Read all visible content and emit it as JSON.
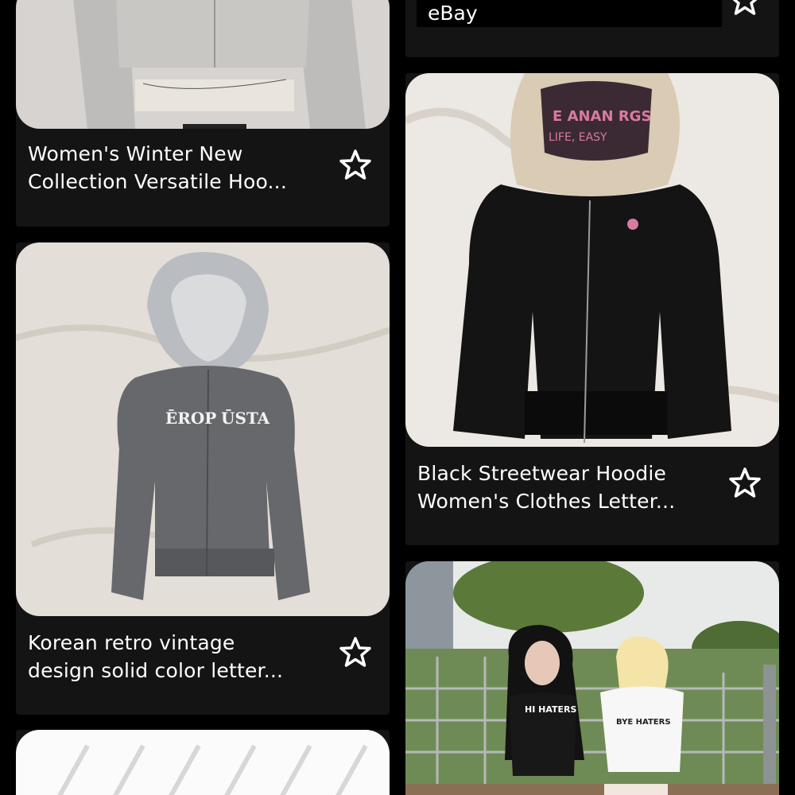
{
  "feed": {
    "items": [
      {
        "title_line1": "Women's Winter New",
        "title_line2": "Collection Versatile Hoo...",
        "favorite_icon": "star-outline-icon",
        "image": "grey-zip-hoodie-photo"
      },
      {
        "source": "eBay",
        "favorite_icon": "star-outline-icon"
      },
      {
        "title_line1": "Black Streetwear Hoodie",
        "title_line2": "Women's Clothes Letter...",
        "favorite_icon": "star-outline-icon",
        "image": "black-fur-hood-hoodie-photo"
      },
      {
        "title_line1": "Korean retro vintage",
        "title_line2": "design solid color letter...",
        "favorite_icon": "star-outline-icon",
        "image": "grey-fur-hood-hoodie-photo"
      },
      {
        "image": "patterned-product-photo"
      },
      {
        "image": "two-women-outdoor-photo",
        "shirt_text_left": "HI HATERS",
        "shirt_text_right": "BYE HATERS"
      }
    ]
  },
  "colors": {
    "background": "#000000",
    "card": "#141414",
    "text": "#ffffff"
  }
}
